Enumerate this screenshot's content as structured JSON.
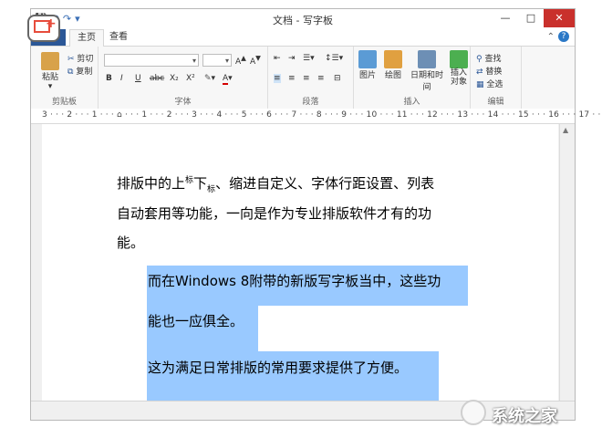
{
  "window": {
    "title": "文档 - 写字板",
    "controls": [
      "—",
      "□",
      "✕"
    ]
  },
  "ribbon": {
    "tabs": [
      {
        "label": "主页"
      },
      {
        "label": "查看"
      }
    ],
    "file_tab_label": "",
    "clipboard": {
      "paste": "粘贴",
      "cut": "剪切",
      "copy": "复制",
      "group": "剪贴板"
    },
    "font": {
      "group": "字体",
      "buttons": [
        "B",
        "I",
        "U",
        "abc",
        "X₂",
        "X²"
      ]
    },
    "paragraph": {
      "group": "段落"
    },
    "insert": {
      "group": "插入",
      "picture": "图片",
      "drawing": "绘图",
      "datetime": "日期和时间",
      "object": "插入对象"
    },
    "editing": {
      "group": "编辑",
      "find": "查找",
      "replace": "替换",
      "select_all": "全选"
    }
  },
  "ruler": {
    "text": "3 · · · 2 · · · 1 · · · ⌂ · · · 1 · · · 2 · · · 3 · · · 4 · · · 5 · · · 6 · · · 7 · · · 8 · · · 9 · · · 10 · · · 11 · · · 12 · · · 13 · · · 14 · · · 15 · · · 16 · · · 17 · · · 18"
  },
  "document": {
    "lines": [
      {
        "pre": "排版中的上",
        "sup": "标",
        "mid": "下",
        "sub": "标",
        "post": "、缩进自定义、字体行距设置、列表"
      },
      {
        "text": "自动套用等功能，一向是作为专业排版软件才有的功"
      },
      {
        "text": "能。"
      },
      {
        "text": "而在Windows 8附带的新版写字板当中，这些功"
      },
      {
        "text": "能也一应俱全。"
      },
      {
        "text": "这为满足日常排版的常用要求提供了方便。"
      }
    ]
  },
  "watermark": {
    "text": "系统之家"
  },
  "colors": {
    "accent": "#2b5797",
    "selection": "#99c9ff",
    "close_button": "#c9302c"
  }
}
